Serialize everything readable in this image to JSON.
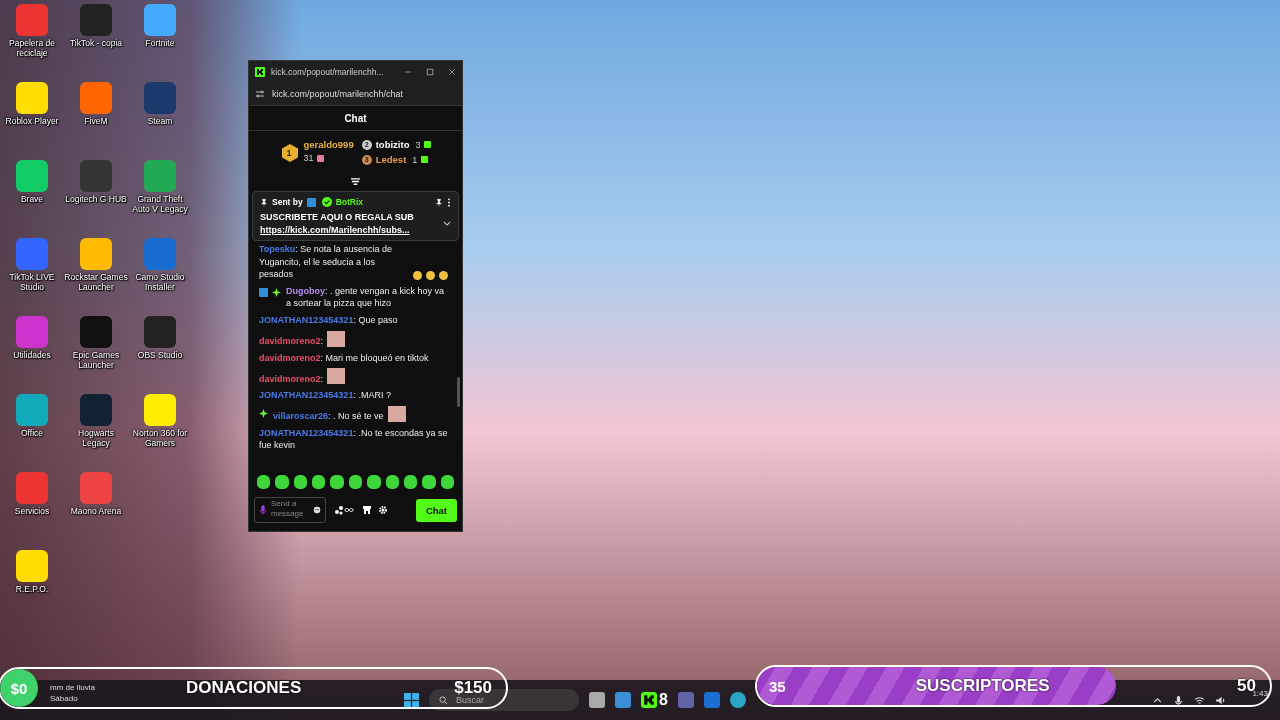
{
  "desktop_columns": [
    [
      {
        "label": "Papelera de reciclaje"
      },
      {
        "label": "Roblox Player"
      },
      {
        "label": "Brave"
      },
      {
        "label": "TikTok LIVE Studio"
      },
      {
        "label": "Utilidades"
      },
      {
        "label": "Office"
      },
      {
        "label": "Servicios"
      },
      {
        "label": "R.E.P.O."
      }
    ],
    [
      {
        "label": "TikTok - copia"
      },
      {
        "label": "FiveM"
      },
      {
        "label": "Logitech G HUB"
      },
      {
        "label": "Rockstar Games Launcher"
      },
      {
        "label": "Epic Games Launcher"
      },
      {
        "label": "Hogwarts Legacy"
      },
      {
        "label": "Maono Arena"
      }
    ],
    [
      {
        "label": "Fortnite"
      },
      {
        "label": "Steam"
      },
      {
        "label": "Grand Theft Auto V Legacy"
      },
      {
        "label": "Camo Studio Installer"
      },
      {
        "label": "OBS Studio"
      },
      {
        "label": "Norton 360 for Gamers"
      }
    ]
  ],
  "chat_window": {
    "title": "kick.com/popout/marilenchh...",
    "address": "kick.com/popout/marilenchh/chat",
    "header": "Chat",
    "leaderboard": [
      {
        "rank": "1",
        "name": "geraldo999",
        "count": "31",
        "color": "#e8b04a"
      },
      {
        "rank": "2",
        "name": "tobizito",
        "count": "3",
        "color": "#ffffff"
      },
      {
        "rank": "3",
        "name": "Ledest",
        "count": "1",
        "color": "#e89a4a"
      }
    ],
    "pinned": {
      "sent_by": "Sent by",
      "sender": "BotRix",
      "title": "SUSCRIBETE AQUI O REGALA SUB",
      "link": "https://kick.com/Marilenchh/subs..."
    },
    "messages": [
      {
        "user": "Topesku",
        "color": "#4a7ae8",
        "text": ": Se nota la ausencia de Yugancito, el le seducia a los pesados",
        "emotes": [
          {
            "kind": "laugh"
          },
          {
            "kind": "laugh"
          },
          {
            "kind": "laugh"
          }
        ]
      },
      {
        "user": "Dugoboy",
        "color": "#b48cf0",
        "text": ": . gente vengan a kick hoy va a sortear la pizza que hizo",
        "badges": [
          {
            "kind": "moderator"
          },
          {
            "kind": "sparkle"
          }
        ]
      },
      {
        "user": "JONATHAN123454321",
        "color": "#4a7ae8",
        "text": ": Que paso"
      },
      {
        "user": "davidmoreno2",
        "color": "#e8506a",
        "text": ":",
        "emotes": [
          {
            "kind": "photo"
          }
        ]
      },
      {
        "user": "davidmoreno2",
        "color": "#e8506a",
        "text": ": Mari me bloqueó en tiktok"
      },
      {
        "user": "davidmoreno2",
        "color": "#e8506a",
        "text": ":",
        "emotes": [
          {
            "kind": "photo"
          }
        ]
      },
      {
        "user": "JONATHAN123454321",
        "color": "#4a7ae8",
        "text": ": .MARI ?"
      },
      {
        "user": "villaroscar26",
        "color": "#4a7ae8",
        "text": ": . No sé te ve",
        "badges": [
          {
            "kind": "sparkle"
          }
        ],
        "emotes": [
          {
            "kind": "photo"
          }
        ]
      },
      {
        "user": "JONATHAN123454321",
        "color": "#4a7ae8",
        "text": ": .No te escondas ya se fue kevin"
      }
    ],
    "input": {
      "placeholder": "Send a message"
    },
    "send_button": "Chat"
  },
  "donations": {
    "current": "$0",
    "label": "DONACIONES",
    "goal": "$150",
    "level": 0
  },
  "subscribers": {
    "current": "35",
    "label": "SUSCRIPTORES",
    "goal": "50",
    "level": 0.7
  },
  "taskbar": {
    "weather": "mm de lluvia",
    "day": "Sábado",
    "search_placeholder": "Buscar",
    "kick_badge": "8",
    "time": "1:43"
  }
}
